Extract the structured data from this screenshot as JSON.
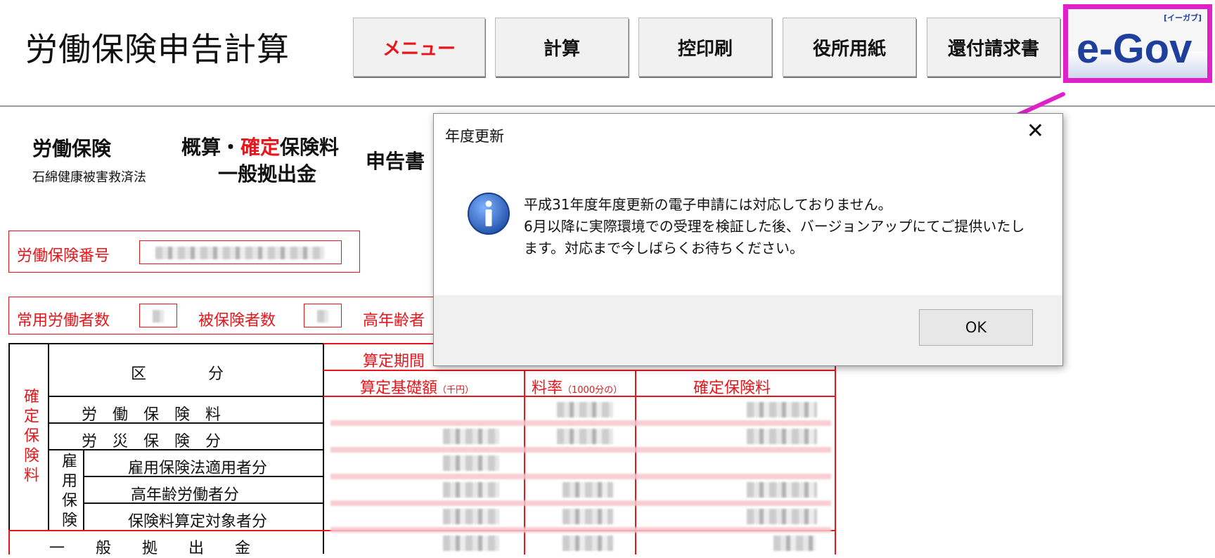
{
  "app": {
    "title": "労働保険申告計算"
  },
  "toolbar": {
    "buttons": [
      {
        "label": "メニュー"
      },
      {
        "label": "計算"
      },
      {
        "label": "控印刷"
      },
      {
        "label": "役所用紙"
      },
      {
        "label": "還付請求書"
      }
    ],
    "egov": {
      "logo": "e-Gov",
      "kana": "[イーガブ]"
    }
  },
  "form": {
    "title_left": "労働保険",
    "subtitle_left": "石綿健康被害救済法",
    "title_mid_1": "概算・",
    "title_mid_red": "確定",
    "title_mid_2": "保険料",
    "title_mid_line2": "一般拠出金",
    "title_right": "申告書",
    "insurance_number_label": "労働保険番号",
    "workers_label": "常用労働者数",
    "insured_label": "被保険者数",
    "elderly_label": "高年齢者",
    "table": {
      "left_header": "確定保険料",
      "col_kubun": "区　　　　分",
      "col_period": "算定期間",
      "col_base": "算定基礎額",
      "col_base_unit": "（千円）",
      "col_rate": "料率",
      "col_rate_unit": "（1000分の）",
      "col_premium": "確定保険料",
      "rows": [
        "労　働　保　険　料",
        "労　災　保　険　分",
        "雇用保険法適用者分",
        "高年齢労働者分",
        "保険料算定対象者分"
      ],
      "koyou_group": "雇用保険",
      "general_contribution": "一　　般　　拠　　出　　金"
    }
  },
  "dialog": {
    "title": "年度更新",
    "message_lines": [
      "平成31年度年度更新の電子申請には対応しておりません。",
      "6月以降に実際環境での受理を検証した後、バージョンアップにてご提供いたし",
      "ます。対応まで今しばらくお待ちください。"
    ],
    "ok_label": "OK",
    "icon": "info-icon"
  },
  "colors": {
    "accent_red": "#e8151b",
    "highlight_magenta": "#e020c8",
    "info_blue": "#1e5fb8"
  }
}
